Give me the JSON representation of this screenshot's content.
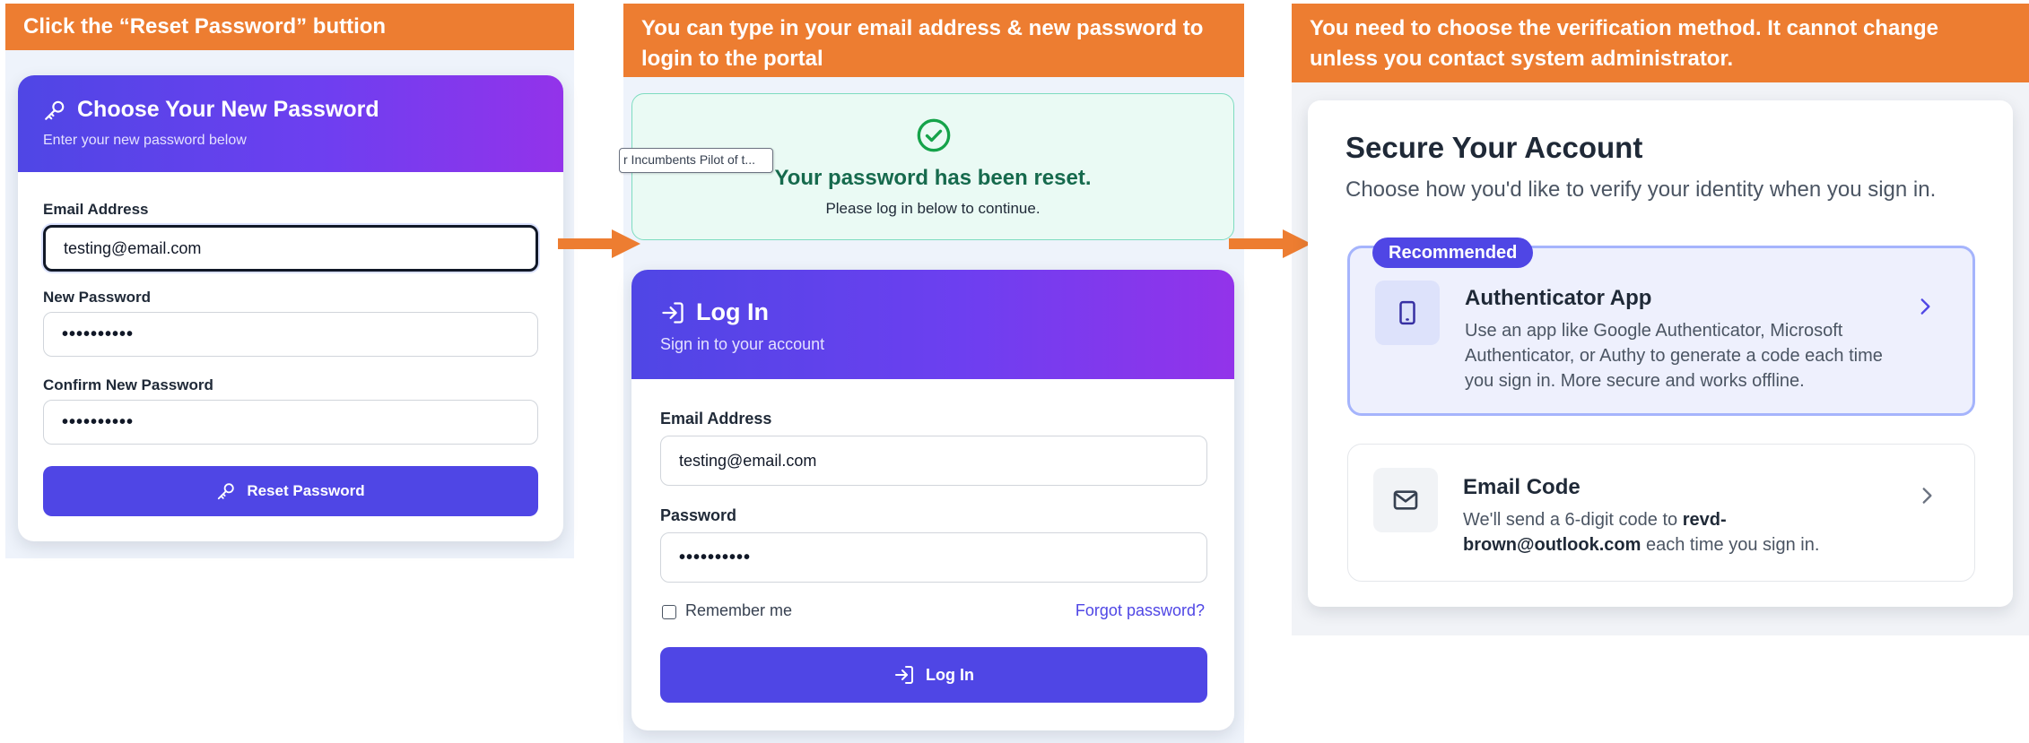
{
  "instructions": {
    "step1": "Click the “Reset Password” buttion",
    "step2_line1": "You can type in your email address & new password to",
    "step2_line2": "login to the portal",
    "step3_line1": "You need to choose the verification method. It cannot change",
    "step3_line2": "unless you contact system administrator."
  },
  "reset_form": {
    "title": "Choose Your New Password",
    "subtitle": "Enter your new password below",
    "email_label": "Email Address",
    "email_value": "testing@email.com",
    "new_password_label": "New Password",
    "new_password_value": "••••••••••",
    "confirm_label": "Confirm New Password",
    "confirm_value": "••••••••••",
    "button_label": "Reset Password"
  },
  "success_message": {
    "title": "Your password has been reset.",
    "subtitle": "Please log in below to continue.",
    "tooltip": "r Incumbents Pilot of t..."
  },
  "login_form": {
    "title": "Log In",
    "subtitle": "Sign in to your account",
    "email_label": "Email Address",
    "email_value": "testing@email.com",
    "password_label": "Password",
    "password_value": "••••••••••",
    "remember_label": "Remember me",
    "forgot_label": "Forgot password?",
    "button_label": "Log In"
  },
  "secure_account": {
    "title": "Secure Your Account",
    "subtitle": "Choose how you'd like to verify your identity when you sign in.",
    "badge": "Recommended",
    "options": [
      {
        "title": "Authenticator App",
        "description": "Use an app like Google Authenticator, Microsoft Authenticator, or Authy to generate a code each time you sign in. More secure and works offline."
      },
      {
        "title": "Email Code",
        "desc_before": "We'll send a 6-digit code to ",
        "desc_email": "revd-brown@outlook.com",
        "desc_after": " each time you sign in."
      }
    ]
  },
  "colors": {
    "banner": "#ed7d31",
    "accent": "#4f46e5",
    "gradient_end": "#9333ea",
    "success_bg": "#eafaf4",
    "success_text": "#166a4d"
  },
  "icons": [
    "key-icon",
    "check-circle-icon",
    "login-icon",
    "smartphone-icon",
    "mail-icon",
    "chevron-right-icon",
    "arrow-right-icon"
  ]
}
